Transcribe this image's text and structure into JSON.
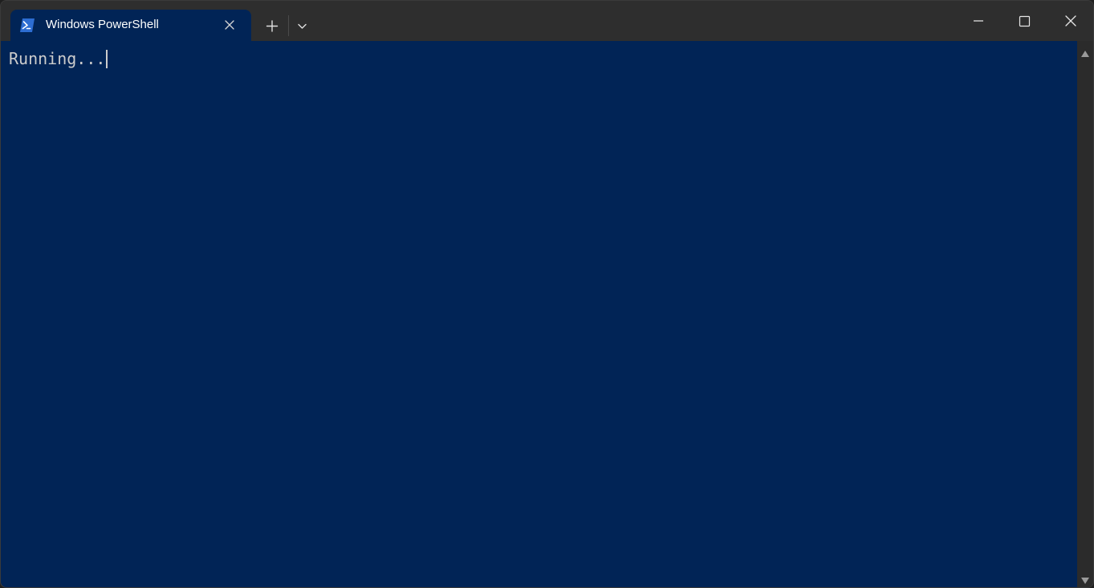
{
  "window": {
    "title": "Windows PowerShell"
  },
  "tab": {
    "title": "Windows PowerShell",
    "icon": "powershell-icon"
  },
  "toolbar": {
    "new_tab_icon": "plus-icon",
    "dropdown_icon": "chevron-down-icon"
  },
  "window_controls": {
    "minimize_icon": "minimize-icon",
    "maximize_icon": "maximize-icon",
    "close_icon": "close-icon"
  },
  "terminal": {
    "lines": [
      "Running..."
    ]
  },
  "colors": {
    "terminal_background": "#012456",
    "titlebar_background": "#2e2e2e",
    "text": "#cccccc"
  }
}
